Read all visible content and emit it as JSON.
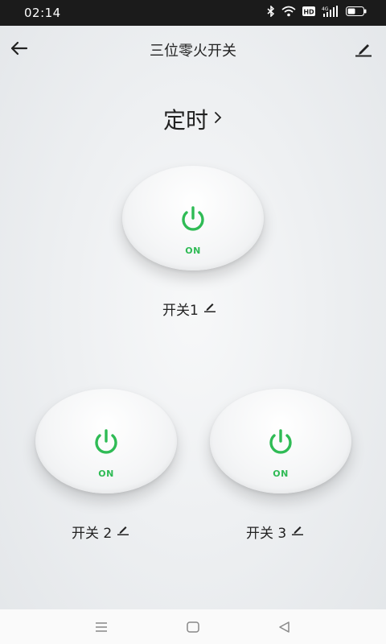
{
  "status_bar": {
    "time": "02:14",
    "icons": [
      "bluetooth-icon",
      "wifi-icon",
      "hd-icon",
      "4g-signal-icon",
      "battery-icon"
    ],
    "hd_label": "HD",
    "net_label": "4G"
  },
  "app_bar": {
    "title": "三位零火开关",
    "back_icon": "arrow-left-icon",
    "edit_icon": "pencil-icon"
  },
  "timer": {
    "label": "定时",
    "icon": "chevron-right-icon"
  },
  "switches": [
    {
      "name": "开关1",
      "state": "ON"
    },
    {
      "name": "开关 2",
      "state": "ON"
    },
    {
      "name": "开关 3",
      "state": "ON"
    }
  ],
  "colors": {
    "accent_green": "#2fbb55",
    "status_bar": "#1b1b1b",
    "text": "#222222"
  },
  "nav_bar": {
    "icons": [
      "menu-icon",
      "home-icon",
      "back-triangle-icon"
    ]
  }
}
